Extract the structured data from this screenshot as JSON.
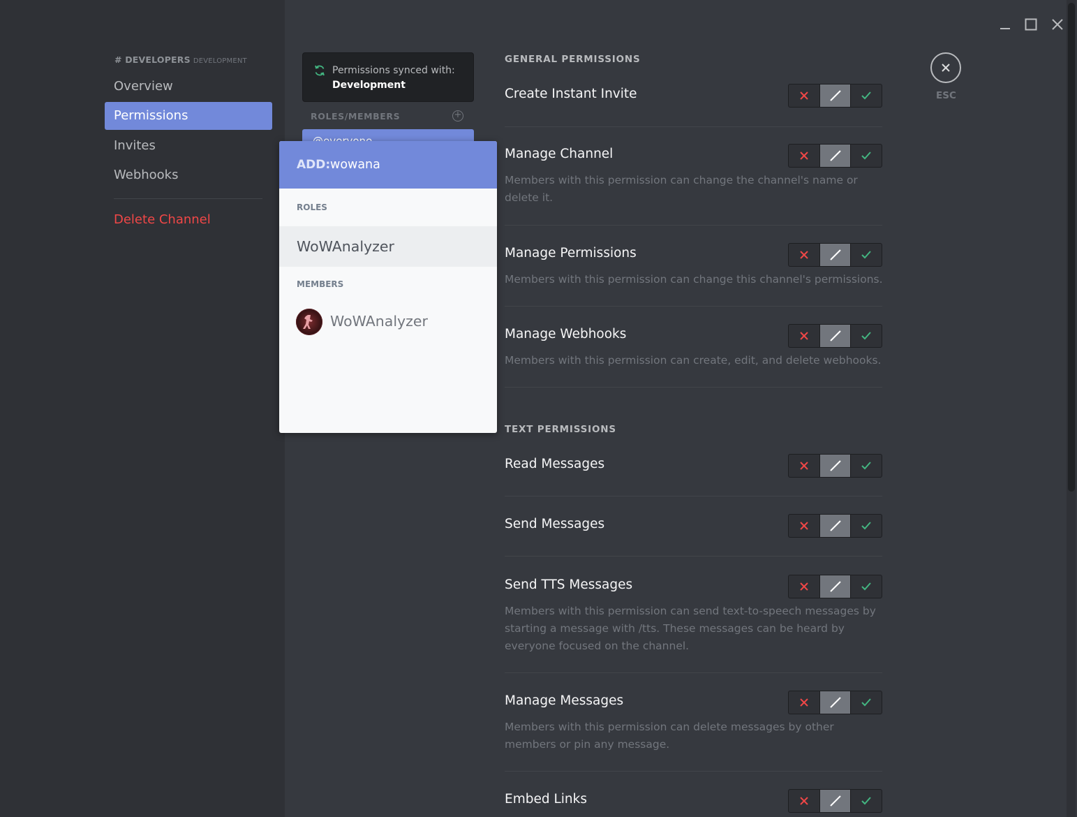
{
  "sidebar": {
    "channel_name": "# DEVELOPERS",
    "category": "DEVELOPMENT",
    "items": [
      {
        "label": "Overview"
      },
      {
        "label": "Permissions"
      },
      {
        "label": "Invites"
      },
      {
        "label": "Webhooks"
      }
    ],
    "delete_label": "Delete Channel"
  },
  "roles": {
    "sync_text": "Permissions synced with:",
    "sync_target": "Development",
    "header": "ROLES/MEMBERS",
    "selected_role": "@everyone"
  },
  "add_popup": {
    "label": "ADD:",
    "query": "wowana",
    "roles_header": "ROLES",
    "role_result": "WoWAnalyzer",
    "members_header": "MEMBERS",
    "member_result": "WoWAnalyzer"
  },
  "permissions": {
    "general_header": "GENERAL PERMISSIONS",
    "text_header": "TEXT PERMISSIONS",
    "items": [
      {
        "title": "Create Instant Invite",
        "desc": ""
      },
      {
        "title": "Manage Channel",
        "desc": "Members with this permission can change the channel's name or delete it."
      },
      {
        "title": "Manage Permissions",
        "desc": "Members with this permission can change this channel's permissions."
      },
      {
        "title": "Manage Webhooks",
        "desc": "Members with this permission can create, edit, and delete webhooks."
      },
      {
        "title": "Read Messages",
        "desc": ""
      },
      {
        "title": "Send Messages",
        "desc": ""
      },
      {
        "title": "Send TTS Messages",
        "desc": "Members with this permission can send text-to-speech messages by starting a message with /tts. These messages can be heard by everyone focused on the channel."
      },
      {
        "title": "Manage Messages",
        "desc": "Members with this permission can delete messages by other members or pin any message."
      },
      {
        "title": "Embed Links",
        "desc": ""
      }
    ]
  },
  "close": {
    "label": "ESC"
  },
  "colors": {
    "accent": "#7289da",
    "deny": "#f04747",
    "allow": "#43b581",
    "neutral": "#72767d"
  },
  "icons": [
    "sync-icon",
    "add-circle-icon",
    "deny-x-icon",
    "neutral-slash-icon",
    "allow-check-icon",
    "close-icon",
    "minimize-icon",
    "maximize-icon",
    "window-close-icon"
  ]
}
